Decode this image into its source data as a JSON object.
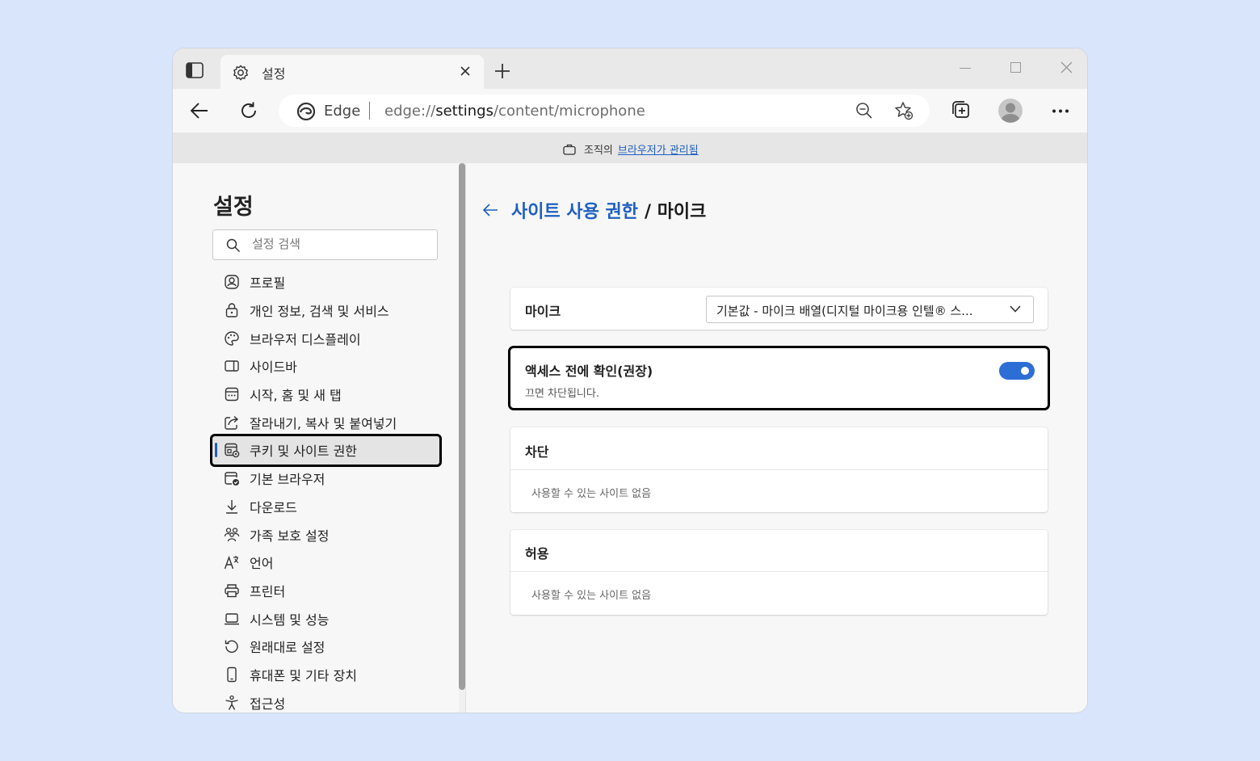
{
  "window": {
    "tab_title": "설정",
    "address_brand": "Edge",
    "url_scheme": "edge://",
    "url_host": "settings",
    "url_path": "/content/microphone"
  },
  "managed": {
    "prefix": "조직의",
    "link": "브라우저가 관리됨"
  },
  "sidebar": {
    "title": "설정",
    "search_placeholder": "설정 검색",
    "items": [
      {
        "label": "프로필",
        "icon": "profile-icon"
      },
      {
        "label": "개인 정보, 검색 및 서비스",
        "icon": "lock-icon"
      },
      {
        "label": "브라우저 디스플레이",
        "icon": "palette-icon"
      },
      {
        "label": "사이드바",
        "icon": "sidebar-icon"
      },
      {
        "label": "시작, 홈 및 새 탭",
        "icon": "home-tab-icon"
      },
      {
        "label": "잘라내기, 복사 및 붙여넣기",
        "icon": "share-icon"
      },
      {
        "label": "쿠키 및 사이트 권한",
        "icon": "cookie-permissions-icon"
      },
      {
        "label": "기본 브라우저",
        "icon": "default-browser-icon"
      },
      {
        "label": "다운로드",
        "icon": "download-icon"
      },
      {
        "label": "가족 보호 설정",
        "icon": "family-icon"
      },
      {
        "label": "언어",
        "icon": "language-icon"
      },
      {
        "label": "프린터",
        "icon": "printer-icon"
      },
      {
        "label": "시스템 및 성능",
        "icon": "laptop-icon"
      },
      {
        "label": "원래대로 설정",
        "icon": "reset-icon"
      },
      {
        "label": "휴대폰 및 기타 장치",
        "icon": "phone-icon"
      },
      {
        "label": "접근성",
        "icon": "accessibility-icon"
      }
    ]
  },
  "main": {
    "breadcrumb_link": "사이트 사용 권한",
    "breadcrumb_current": "/ 마이크",
    "mic": {
      "label": "마이크",
      "selected": "기본값 - 마이크 배열(디지털 마이크용 인텔® 스..."
    },
    "ask": {
      "title": "액세스 전에 확인(권장)",
      "subtitle": "끄면 차단됩니다.",
      "enabled": true
    },
    "block": {
      "title": "차단",
      "empty": "사용할 수 있는 사이트 없음"
    },
    "allow": {
      "title": "허용",
      "empty": "사용할 수 있는 사이트 없음"
    }
  },
  "colors": {
    "accent": "#1e5fc0",
    "toggle": "#2d6ed6",
    "background": "#d8e5fb"
  }
}
